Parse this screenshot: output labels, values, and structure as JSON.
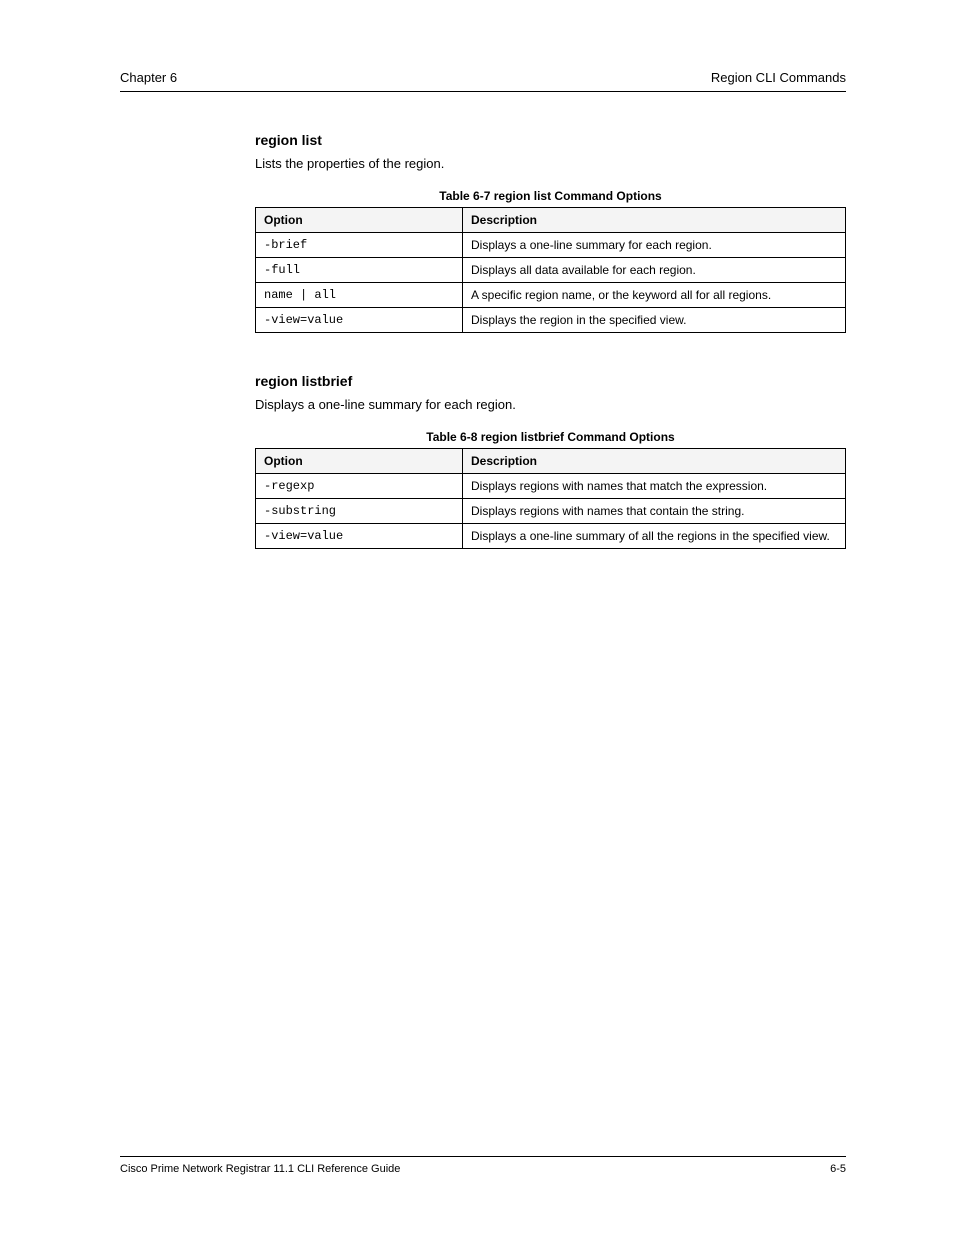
{
  "header": {
    "left": "Chapter 6",
    "right": "Region CLI Commands"
  },
  "section1": {
    "heading": "region list",
    "intro": "Lists the properties of the region.",
    "tabletitle": "Table 6-7   region list Command Options",
    "columns": [
      "Option",
      "Description"
    ],
    "rows": [
      {
        "opt": "-brief",
        "desc": "Displays a one-line summary for each region."
      },
      {
        "opt": "-full",
        "desc": "Displays all data available for each region."
      },
      {
        "opt": "name | all",
        "desc": "A specific region name, or the keyword all for all\nregions."
      },
      {
        "opt": "-view=value",
        "desc": "Displays the region in the specified view."
      }
    ]
  },
  "section2": {
    "heading": "region listbrief",
    "intro": "Displays a one-line summary for each region.",
    "tabletitle": "Table 6-8   region listbrief Command Options",
    "columns": [
      "Option",
      "Description"
    ],
    "rows": [
      {
        "opt": "-regexp",
        "desc": "Displays regions with names that match the expression."
      },
      {
        "opt": "-substring",
        "desc": "Displays regions with names that contain the string."
      },
      {
        "opt": "-view=value",
        "desc": "Displays a one-line summary of all the regions in the\nspecified view."
      }
    ]
  },
  "footer": {
    "left": "Cisco Prime Network Registrar 11.1 CLI Reference Guide",
    "right": "6-5"
  }
}
